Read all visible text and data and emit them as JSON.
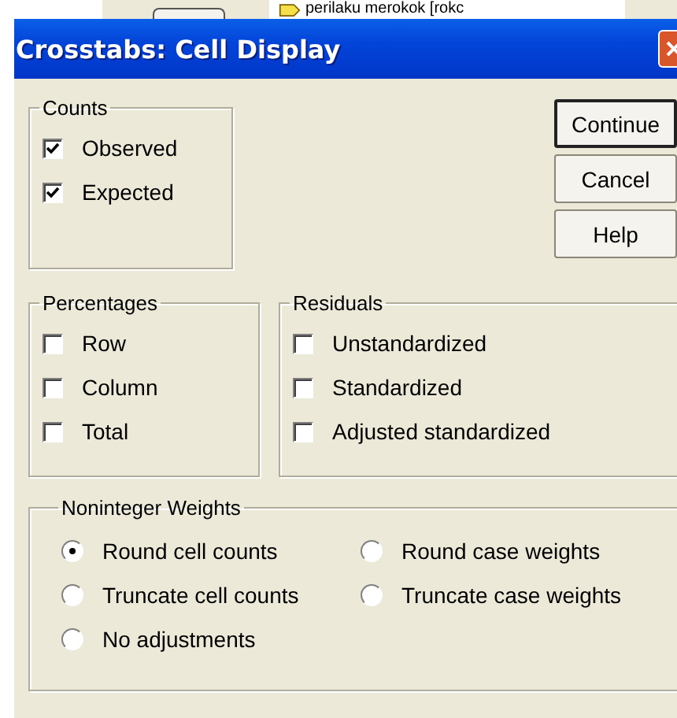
{
  "background_window": {
    "item_label": "perilaku merokok [rokc"
  },
  "window": {
    "title": "Crosstabs: Cell Display"
  },
  "check_groups": [
    {
      "title": "Counts",
      "options": [
        {
          "label": "Observed",
          "checked": true
        },
        {
          "label": "Expected",
          "checked": true
        }
      ]
    },
    {
      "title": "Percentages",
      "options": [
        {
          "label": "Row",
          "checked": false
        },
        {
          "label": "Column",
          "checked": false
        },
        {
          "label": "Total",
          "checked": false
        }
      ]
    },
    {
      "title": "Residuals",
      "options": [
        {
          "label": "Unstandardized",
          "checked": false
        },
        {
          "label": "Standardized",
          "checked": false
        },
        {
          "label": "Adjusted standardized",
          "checked": false
        }
      ]
    }
  ],
  "noninteger_weights": {
    "title": "Noninteger Weights",
    "options": [
      {
        "label": "Round cell counts",
        "selected": true
      },
      {
        "label": "Round case weights",
        "selected": false
      },
      {
        "label": "Truncate cell counts",
        "selected": false
      },
      {
        "label": "Truncate case weights",
        "selected": false
      },
      {
        "label": "No adjustments",
        "selected": false
      }
    ]
  },
  "buttons": [
    {
      "label": "Continue",
      "default": true
    },
    {
      "label": "Cancel",
      "default": false
    },
    {
      "label": "Help",
      "default": false
    }
  ]
}
